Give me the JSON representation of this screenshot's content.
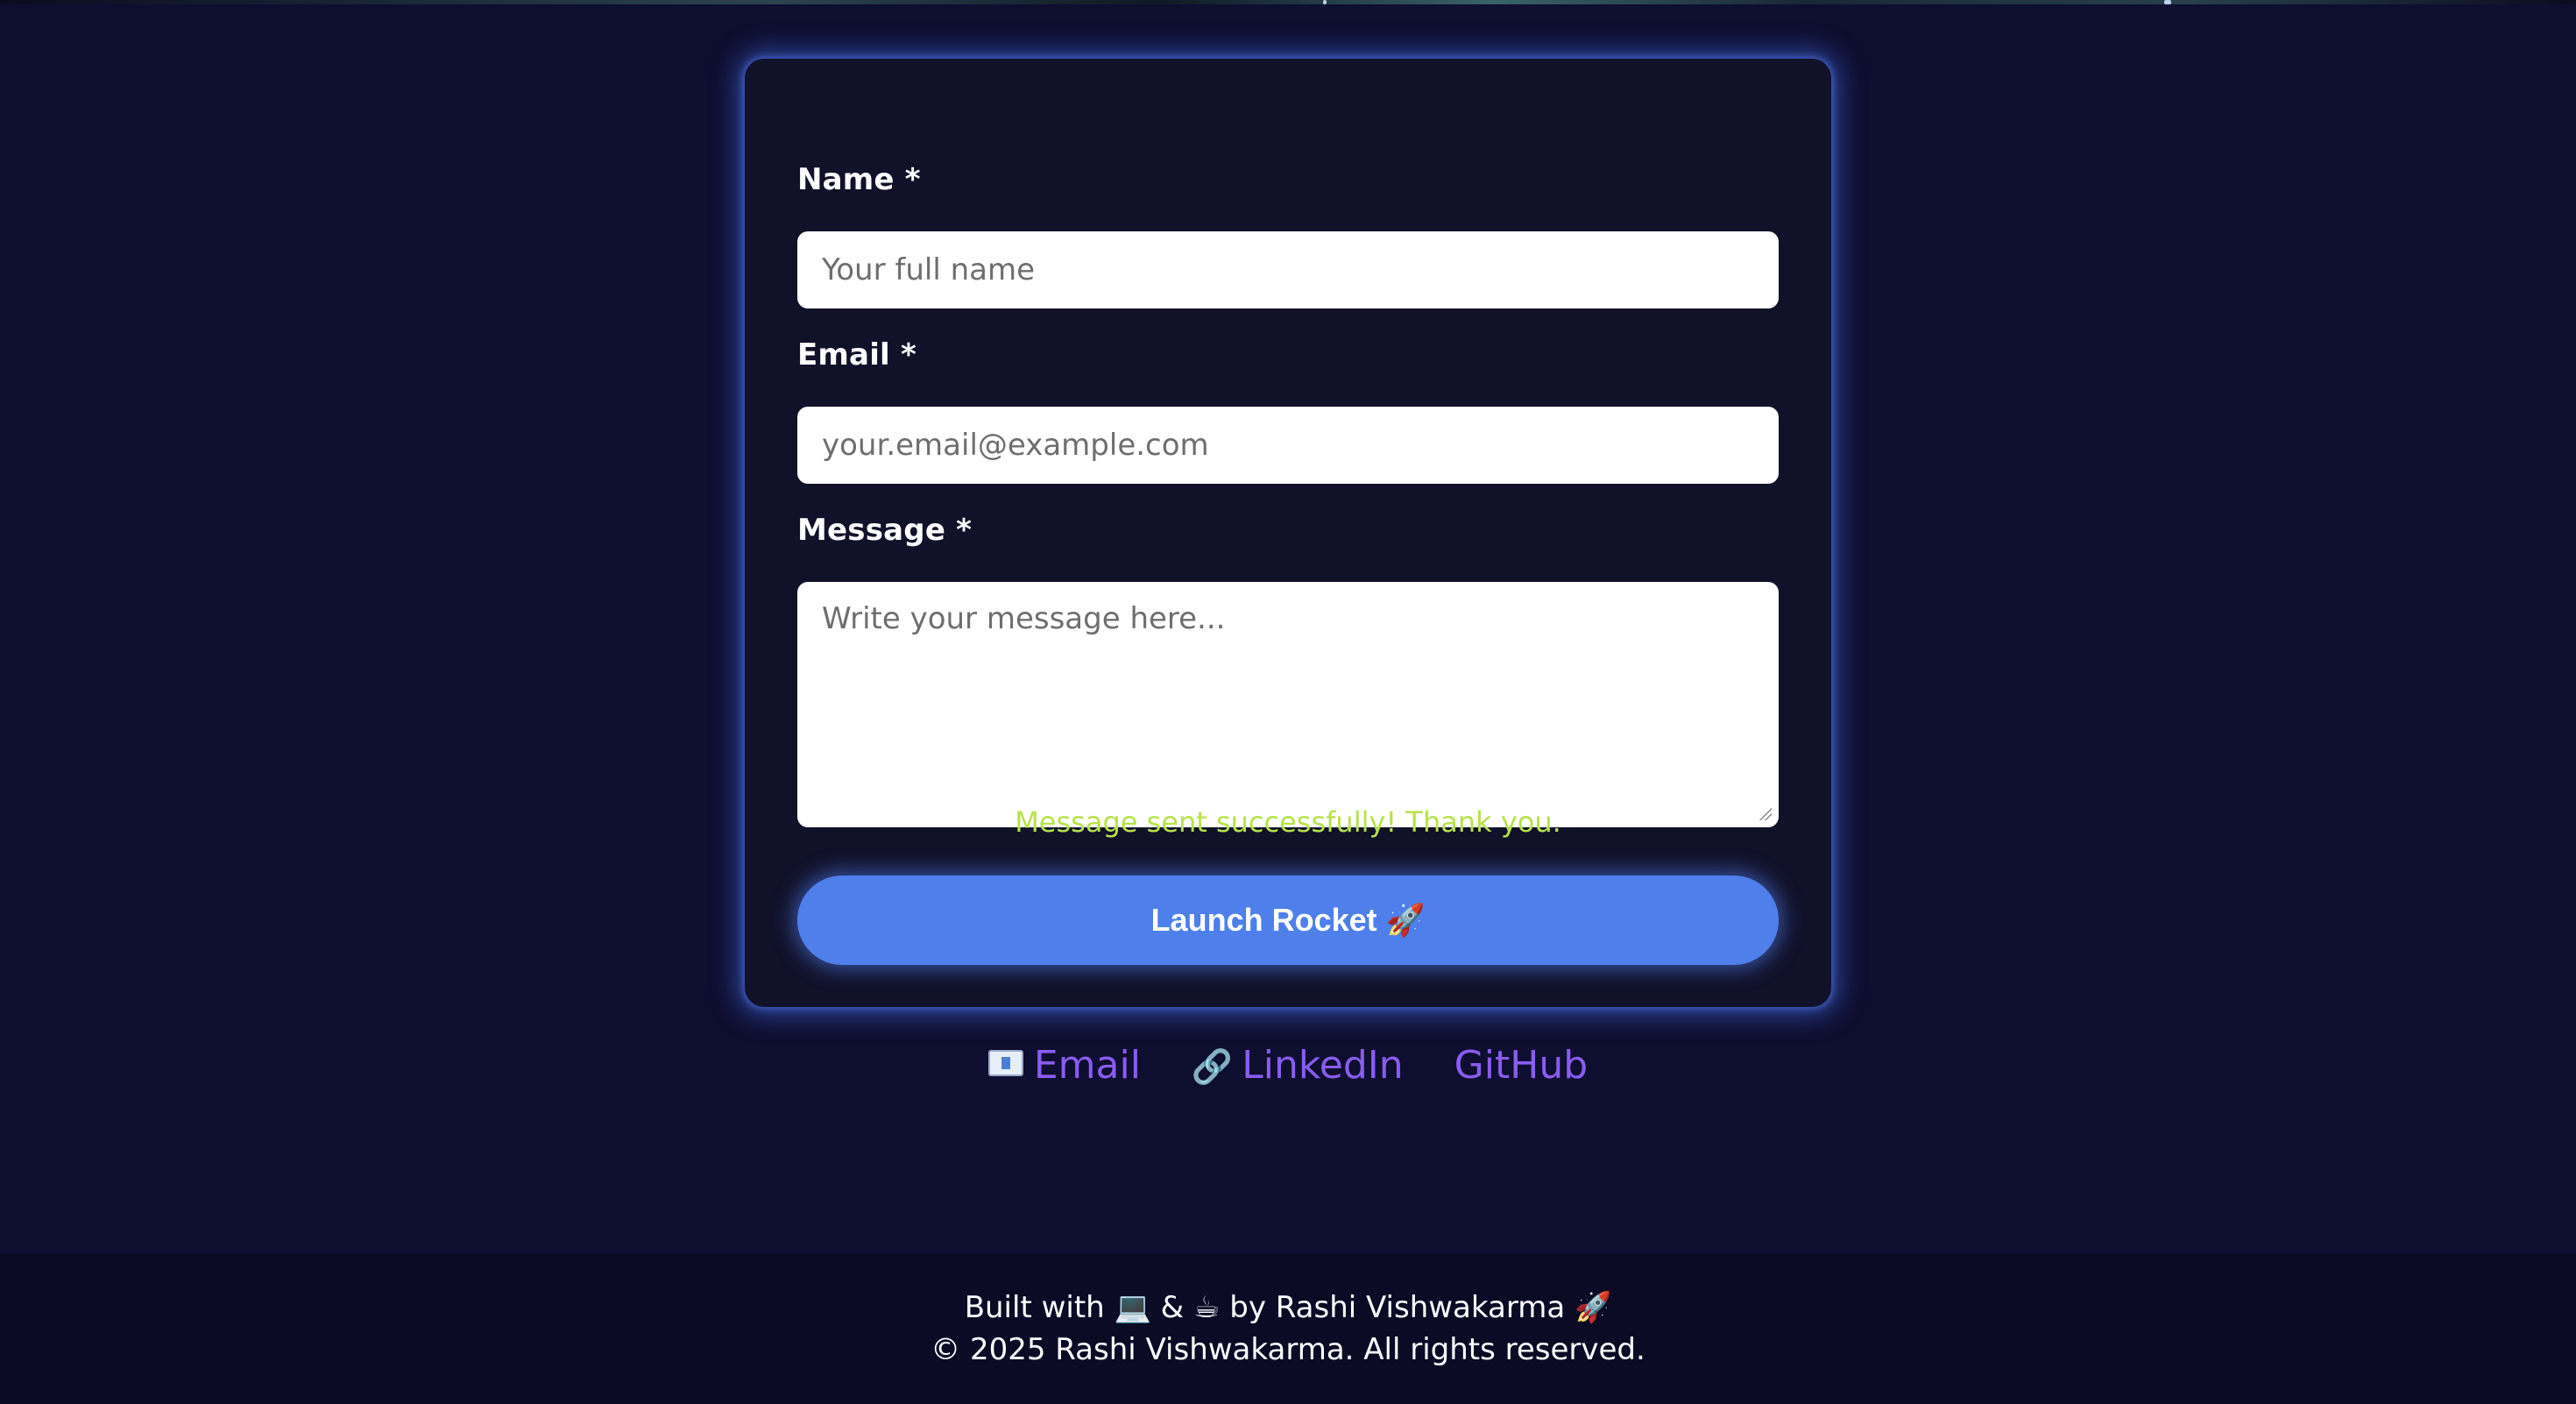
{
  "form": {
    "name_label": "Name *",
    "name_placeholder": "Your full name",
    "email_label": "Email *",
    "email_placeholder": "your.email@example.com",
    "message_label": "Message *",
    "message_placeholder": "Write your message here...",
    "success_text": "Message sent successfully! Thank you.",
    "submit_label": "Launch Rocket 🚀"
  },
  "links": {
    "email_icon": "📧",
    "email_label": "Email",
    "linkedin_icon": "🔗",
    "linkedin_label": "LinkedIn",
    "github_label": "GitHub"
  },
  "footer": {
    "built_with": "Built with 💻 & ☕ by Rashi Vishwakarma 🚀",
    "copyright": "© 2025 Rashi Vishwakarma. All rights reserved."
  },
  "colors": {
    "background": "#0d0d2e",
    "card": "#111129",
    "accent_button": "#4f7fea",
    "success": "#b6e34a",
    "link": "#8a5cf0"
  }
}
